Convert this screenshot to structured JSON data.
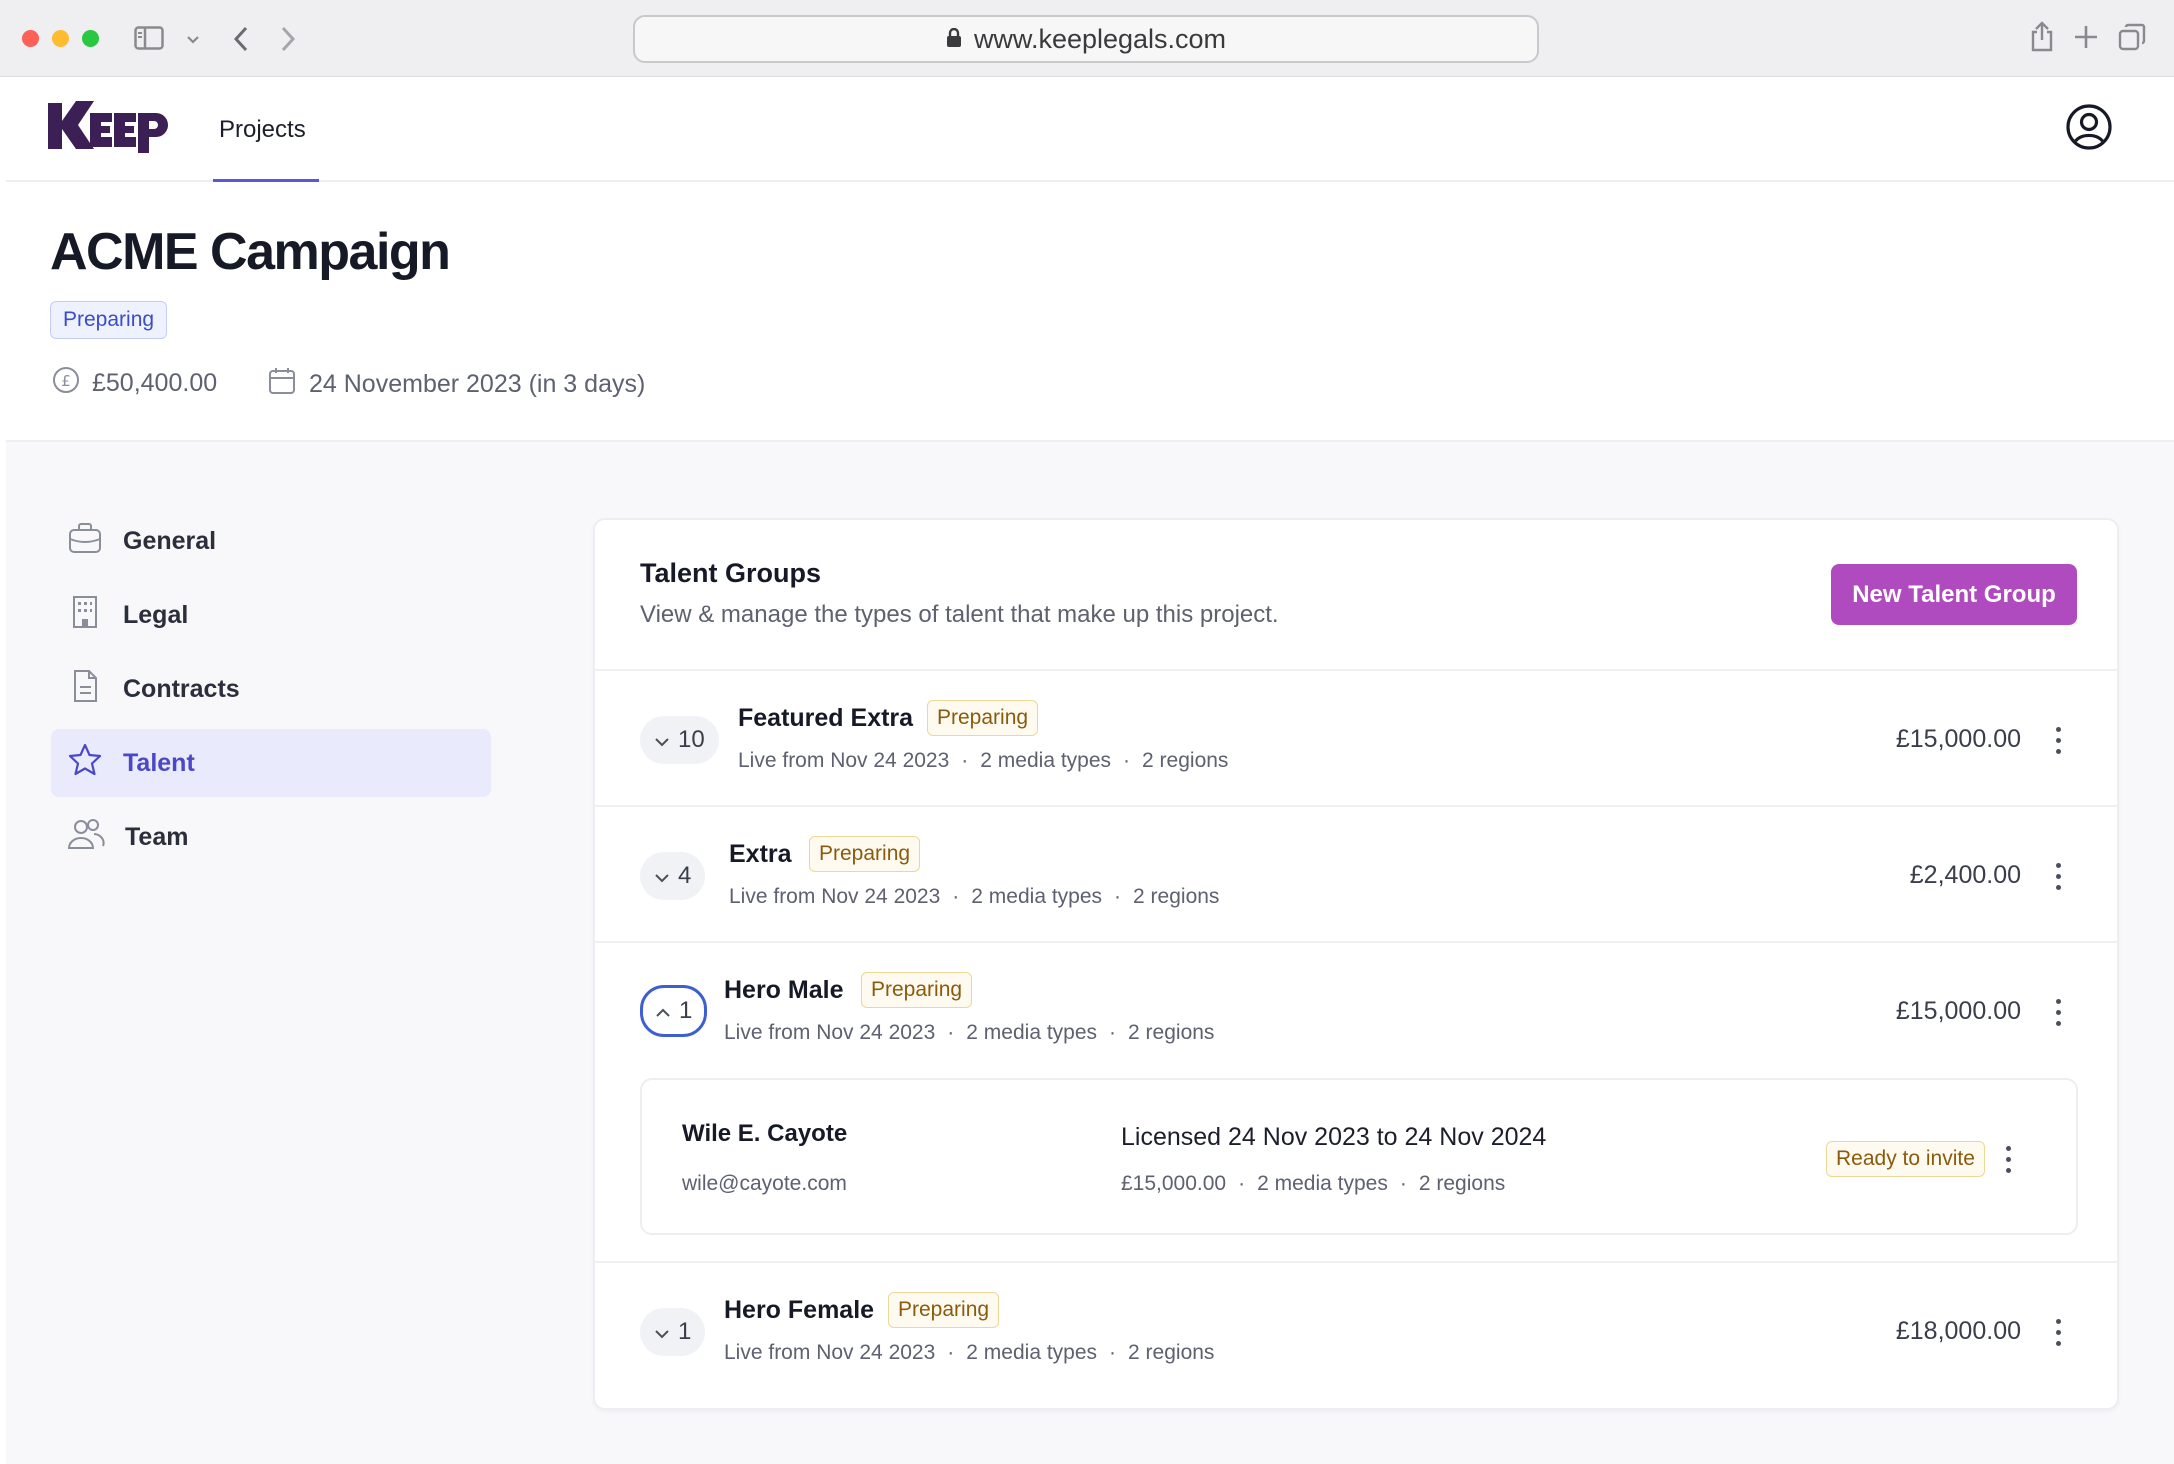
{
  "browser": {
    "url": "www.keeplegals.com"
  },
  "app": {
    "logo_text": "KEEP",
    "nav": {
      "projects_label": "Projects"
    }
  },
  "project": {
    "title": "ACME Campaign",
    "status": "Preparing",
    "budget": "£50,400.00",
    "date": "24 November 2023 (in 3 days)"
  },
  "sidebar": {
    "items": [
      {
        "label": "General",
        "icon": "briefcase-icon"
      },
      {
        "label": "Legal",
        "icon": "building-icon"
      },
      {
        "label": "Contracts",
        "icon": "document-icon"
      },
      {
        "label": "Talent",
        "icon": "star-icon",
        "active": true
      },
      {
        "label": "Team",
        "icon": "users-icon"
      }
    ]
  },
  "talent_groups": {
    "title": "Talent Groups",
    "description": "View & manage the types of talent that make up this project.",
    "new_button": "New Talent Group",
    "groups": [
      {
        "count": "10",
        "name": "Featured Extra",
        "status": "Preparing",
        "live": "Live from Nov 24 2023",
        "media": "2 media types",
        "regions": "2 regions",
        "amount": "£15,000.00",
        "expanded": false
      },
      {
        "count": "4",
        "name": "Extra",
        "status": "Preparing",
        "live": "Live from Nov 24 2023",
        "media": "2 media types",
        "regions": "2 regions",
        "amount": "£2,400.00",
        "expanded": false
      },
      {
        "count": "1",
        "name": "Hero Male",
        "status": "Preparing",
        "live": "Live from Nov 24 2023",
        "media": "2 media types",
        "regions": "2 regions",
        "amount": "£15,000.00",
        "expanded": true
      },
      {
        "count": "1",
        "name": "Hero Female",
        "status": "Preparing",
        "live": "Live from Nov 24 2023",
        "media": "2 media types",
        "regions": "2 regions",
        "amount": "£18,000.00",
        "expanded": false
      }
    ],
    "member": {
      "name": "Wile E. Cayote",
      "email": "wile@cayote.com",
      "license": "Licensed 24 Nov 2023 to 24 Nov 2024",
      "amount": "£15,000.00",
      "media": "2 media types",
      "regions": "2 regions",
      "status": "Ready to invite"
    }
  },
  "separator_dot": "·",
  "colors": {
    "accent": "#5b57d6",
    "primary_button": "#b04bbf",
    "logo": "#3b1f55"
  }
}
